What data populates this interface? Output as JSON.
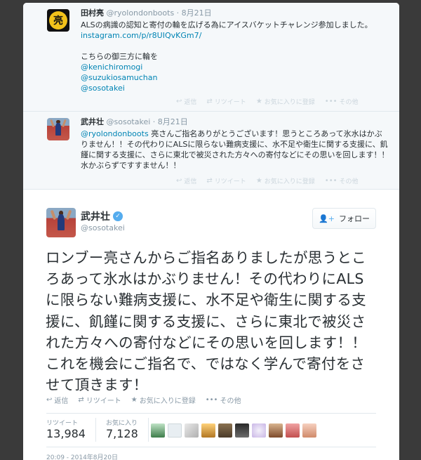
{
  "ancestors": [
    {
      "name": "田村亮",
      "meta": "@ryolondonboots · 8月21日",
      "avatar_text": "亮",
      "lines": [
        {
          "text": "ALSの病識の認知と寄付の輪を広げる為にアイスバケットチャレンジ参加しました。",
          "link": false
        },
        {
          "text": "instagram.com/p/r8UIQvKGm7/",
          "link": true
        },
        {
          "text": "",
          "link": false
        },
        {
          "text": "こちらの御三方に輪を",
          "link": false
        },
        {
          "text": "@kenichiromogi",
          "link": true
        },
        {
          "text": "@suzukiosamuchan",
          "link": true
        },
        {
          "text": "@sosotakei",
          "link": true
        }
      ]
    },
    {
      "name": "武井壮",
      "meta": "@sosotakei · 8月21日",
      "mention": "@ryolondonboots",
      "body": " 亮さんご指名ありがとうございます！思うところあって氷水はかぶりません！！その代わりにALSに限らない難病支援に、水不足や衛生に関する支援に、飢饉に関する支援に、さらに東北で被災された方々への寄付などにその思いを回します！！水かぶらずですすません！！"
    }
  ],
  "small_actions": {
    "reply": "返信",
    "retweet": "リツイート",
    "favorite": "お気に入りに登録",
    "more": "その他"
  },
  "main": {
    "name": "武井壮",
    "handle": "@sosotakei",
    "follow_label": "フォロー",
    "text": "ロンブー亮さんからご指名ありましたが思うところあって氷水はかぶりません！その代わりにALSに限らない難病支援に、水不足や衛生に関する支援に、飢饉に関する支援に、さらに東北で被災された方々への寄付などにその思いを回します！！これを機会にご指名で、ではなく学んで寄付をさせて頂きます！",
    "actions": {
      "reply": "返信",
      "retweet": "リツイート",
      "favorite": "お気に入りに登録",
      "more": "その他"
    },
    "stats": {
      "retweets_label": "リツイート",
      "retweets_value": "13,984",
      "favorites_label": "お気に入り",
      "favorites_value": "7,128"
    },
    "timestamp": "20:09 - 2014年8月20日"
  },
  "colors": {
    "link": "#0084b4",
    "verified": "#55acee",
    "page_bg": "#3a3a3a"
  },
  "icons": {
    "reply": "reply-icon",
    "retweet": "retweet-icon",
    "favorite": "star-icon",
    "more": "more-icon",
    "verified": "verified-badge-icon",
    "follow": "add-user-icon"
  }
}
